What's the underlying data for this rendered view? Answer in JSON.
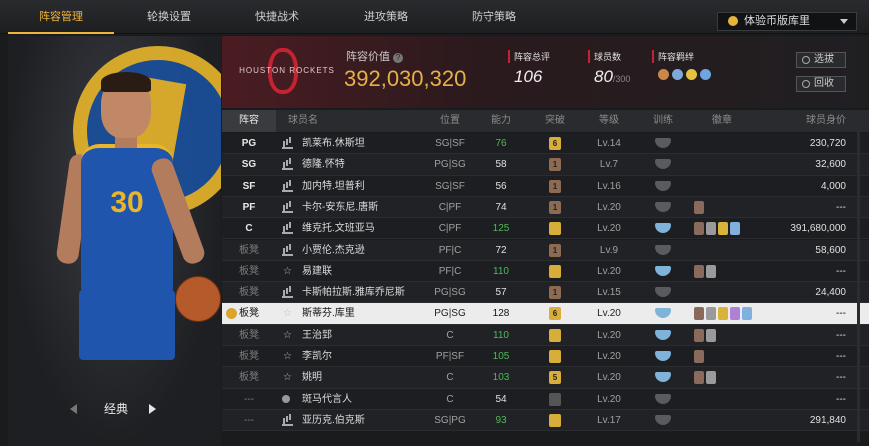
{
  "nav": {
    "tabs": [
      {
        "label": "阵容管理",
        "active": true
      },
      {
        "label": "轮换设置",
        "active": false
      },
      {
        "label": "快捷战术",
        "active": false
      },
      {
        "label": "进攻策略",
        "active": false
      },
      {
        "label": "防守策略",
        "active": false
      }
    ],
    "dropdown_value": "体验币版库里"
  },
  "left_panel": {
    "jersey_number": "30",
    "card_label": "经典"
  },
  "team": {
    "logo_text": "HOUSTON ROCKETS",
    "value_label": "阵容价值",
    "value": "392,030,320",
    "rating_label": "阵容总评",
    "rating": "106",
    "players_label": "球员数",
    "players_count": "80",
    "players_max": "/300",
    "bond_label": "阵容羁绊",
    "bond_colors": [
      "#c8884a",
      "#7fa9d6",
      "#e3c243",
      "#6fa5e0"
    ],
    "select_button": "选拔",
    "recycle_button": "回收"
  },
  "table": {
    "headers": [
      "阵容",
      "球员名",
      "位置",
      "能力",
      "突破",
      "等级",
      "训练",
      "徽章",
      "球员身价"
    ],
    "rows": [
      {
        "slot": "PG",
        "name": "凯莱布.休斯坦",
        "icon": "bars",
        "position": "SG|SF",
        "ability": "76",
        "ability_green": true,
        "breakthrough": "6",
        "tier": "gold",
        "level": "Lv.14",
        "train": "gray",
        "medals": [],
        "value": "230,720",
        "bench": false
      },
      {
        "slot": "SG",
        "name": "德隆.怀特",
        "icon": "bars",
        "position": "PG|SG",
        "ability": "58",
        "ability_green": false,
        "breakthrough": "1",
        "tier": "bronze",
        "level": "Lv.7",
        "train": "gray",
        "medals": [],
        "value": "32,600",
        "bench": false
      },
      {
        "slot": "SF",
        "name": "加内特.坦普利",
        "icon": "bars",
        "position": "SG|SF",
        "ability": "56",
        "ability_green": false,
        "breakthrough": "1",
        "tier": "bronze",
        "level": "Lv.16",
        "train": "gray",
        "medals": [],
        "value": "4,000",
        "bench": false
      },
      {
        "slot": "PF",
        "name": "卡尔-安东尼.唐斯",
        "icon": "bars",
        "position": "C|PF",
        "ability": "74",
        "ability_green": false,
        "breakthrough": "1",
        "tier": "bronze",
        "level": "Lv.20",
        "train": "gray",
        "medals": [
          "#8a6a5a"
        ],
        "value": "---",
        "bench": false
      },
      {
        "slot": "C",
        "name": "维克托.文班亚马",
        "icon": "bars",
        "position": "C|PF",
        "ability": "125",
        "ability_green": true,
        "breakthrough": "",
        "tier": "gold",
        "level": "Lv.20",
        "train": "blue",
        "medals": [
          "#8a6a5a",
          "#9a9a9a",
          "#d9b23a",
          "#7fb0e0"
        ],
        "value": "391,680,000",
        "bench": false
      },
      {
        "slot": "板凳",
        "name": "小贾伦.杰克逊",
        "icon": "bars",
        "position": "PF|C",
        "ability": "72",
        "ability_green": false,
        "breakthrough": "1",
        "tier": "bronze",
        "level": "Lv.9",
        "train": "gray",
        "medals": [],
        "value": "58,600",
        "bench": true
      },
      {
        "slot": "板凳",
        "name": "易建联",
        "icon": "star",
        "position": "PF|C",
        "ability": "110",
        "ability_green": true,
        "breakthrough": "",
        "tier": "gold",
        "level": "Lv.20",
        "train": "blue",
        "medals": [
          "#8a6a5a",
          "#9a9a9a"
        ],
        "value": "---",
        "bench": true
      },
      {
        "slot": "板凳",
        "name": "卡斯帕拉斯.雅库乔尼斯",
        "icon": "bars",
        "position": "PG|SG",
        "ability": "57",
        "ability_green": false,
        "breakthrough": "1",
        "tier": "bronze",
        "level": "Lv.15",
        "train": "gray",
        "medals": [],
        "value": "24,400",
        "bench": true
      },
      {
        "slot": "板凳",
        "name": "斯蒂芬.库里",
        "icon": "star",
        "position": "PG|SG",
        "ability": "128",
        "ability_green": false,
        "breakthrough": "6",
        "tier": "gold",
        "level": "Lv.20",
        "train": "blue",
        "medals": [
          "#8a6a5a",
          "#9a9a9a",
          "#d9b23a",
          "#b07fd6",
          "#7fb0e0"
        ],
        "value": "---",
        "bench": true,
        "selected": true
      },
      {
        "slot": "板凳",
        "name": "王治郅",
        "icon": "star",
        "position": "C",
        "ability": "110",
        "ability_green": true,
        "breakthrough": "",
        "tier": "gold",
        "level": "Lv.20",
        "train": "blue",
        "medals": [
          "#8a6a5a",
          "#9a9a9a"
        ],
        "value": "---",
        "bench": true
      },
      {
        "slot": "板凳",
        "name": "李凯尔",
        "icon": "star",
        "position": "PF|SF",
        "ability": "105",
        "ability_green": true,
        "breakthrough": "",
        "tier": "gold",
        "level": "Lv.20",
        "train": "blue",
        "medals": [
          "#8a6a5a"
        ],
        "value": "---",
        "bench": true
      },
      {
        "slot": "板凳",
        "name": "姚明",
        "icon": "star",
        "position": "C",
        "ability": "103",
        "ability_green": true,
        "breakthrough": "5",
        "tier": "gold",
        "level": "Lv.20",
        "train": "blue",
        "medals": [
          "#8a6a5a",
          "#9a9a9a"
        ],
        "value": "---",
        "bench": true
      },
      {
        "slot": "---",
        "name": "斑马代言人",
        "icon": "person",
        "position": "C",
        "ability": "54",
        "ability_green": false,
        "breakthrough": "",
        "tier": "gray",
        "level": "Lv.20",
        "train": "gray",
        "medals": [],
        "value": "---",
        "bench": true
      },
      {
        "slot": "---",
        "name": "亚历克.伯克斯",
        "icon": "bars",
        "position": "SG|PG",
        "ability": "93",
        "ability_green": true,
        "breakthrough": "",
        "tier": "gold",
        "level": "Lv.17",
        "train": "gray",
        "medals": [],
        "value": "291,840",
        "bench": true
      }
    ]
  },
  "colors": {
    "accent": "#f0b43a",
    "green": "#4fba55",
    "selected_row": "#ececec"
  }
}
